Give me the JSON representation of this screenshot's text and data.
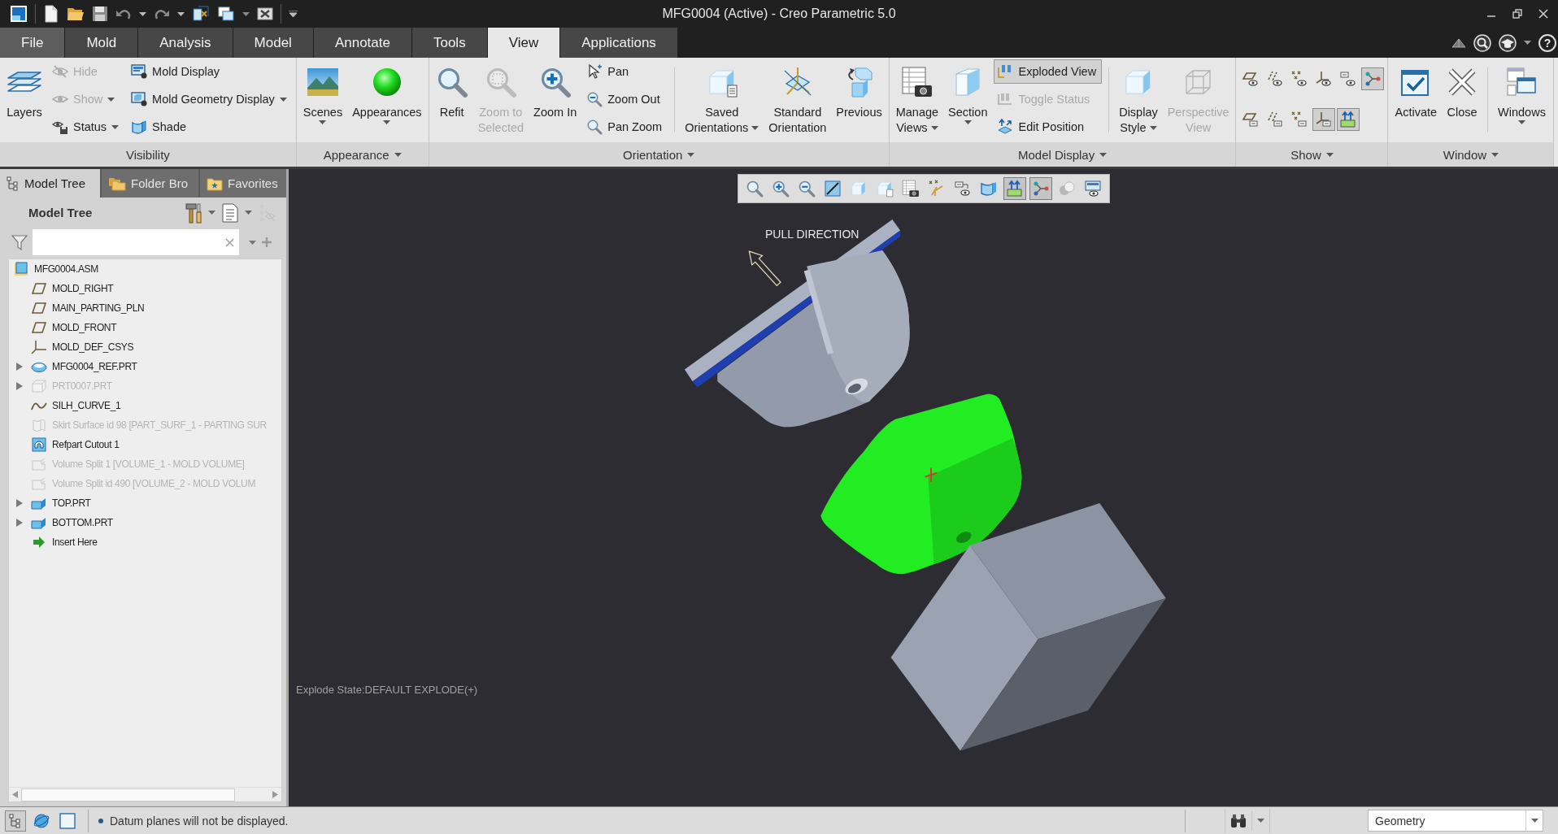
{
  "window": {
    "title": "MFG0004 (Active) - Creo Parametric 5.0"
  },
  "tabs": [
    {
      "label": "File",
      "selected": false
    },
    {
      "label": "Mold",
      "selected": false
    },
    {
      "label": "Analysis",
      "selected": false
    },
    {
      "label": "Model",
      "selected": false
    },
    {
      "label": "Annotate",
      "selected": false
    },
    {
      "label": "Tools",
      "selected": false
    },
    {
      "label": "View",
      "selected": true
    },
    {
      "label": "Applications",
      "selected": false
    }
  ],
  "help": "?",
  "ribbon": [
    {
      "label": "Visibility",
      "menu": false,
      "items": [
        {
          "kind": "large",
          "lines": [
            "Layers"
          ],
          "dropdown": false,
          "disabled": false
        },
        {
          "kind": "stack",
          "items": [
            {
              "label": "Hide",
              "dropdown": false,
              "disabled": true,
              "on": false
            },
            {
              "label": "Show",
              "dropdown": true,
              "disabled": true,
              "on": false
            },
            {
              "label": "Status",
              "dropdown": true,
              "disabled": false,
              "on": false
            }
          ]
        },
        {
          "kind": "stack",
          "items": [
            {
              "label": "Mold Display",
              "dropdown": false,
              "disabled": false,
              "on": false
            },
            {
              "label": "Mold Geometry Display",
              "dropdown": true,
              "disabled": false,
              "on": false
            },
            {
              "label": "Shade",
              "dropdown": false,
              "disabled": false,
              "on": false
            }
          ]
        }
      ]
    },
    {
      "label": "Appearance",
      "menu": true,
      "items": [
        {
          "kind": "large",
          "lines": [
            "Scenes"
          ],
          "dropdown": true,
          "disabled": false
        },
        {
          "kind": "large",
          "lines": [
            "Appearances"
          ],
          "dropdown": true,
          "disabled": false
        }
      ]
    },
    {
      "label": "Orientation",
      "menu": true,
      "items": [
        {
          "kind": "large",
          "lines": [
            "Refit"
          ],
          "dropdown": false,
          "disabled": false
        },
        {
          "kind": "large",
          "lines": [
            "Zoom to",
            "Selected"
          ],
          "dropdown": false,
          "disabled": true
        },
        {
          "kind": "large",
          "lines": [
            "Zoom In"
          ],
          "dropdown": false,
          "disabled": false
        },
        {
          "kind": "stack",
          "items": [
            {
              "label": "Pan",
              "dropdown": false,
              "disabled": false,
              "on": false
            },
            {
              "label": "Zoom Out",
              "dropdown": false,
              "disabled": false,
              "on": false
            },
            {
              "label": "Pan Zoom",
              "dropdown": false,
              "disabled": false,
              "on": false
            }
          ]
        },
        {
          "kind": "separator"
        },
        {
          "kind": "large",
          "lines": [
            "Saved",
            "Orientations"
          ],
          "dropdown": true,
          "disabled": false
        },
        {
          "kind": "large",
          "lines": [
            "Standard",
            "Orientation"
          ],
          "dropdown": false,
          "disabled": false
        },
        {
          "kind": "large",
          "lines": [
            "Previous"
          ],
          "dropdown": false,
          "disabled": false
        }
      ]
    },
    {
      "label": "Model Display",
      "menu": true,
      "items": [
        {
          "kind": "large",
          "lines": [
            "Manage",
            "Views"
          ],
          "dropdown": true,
          "disabled": false
        },
        {
          "kind": "large",
          "lines": [
            "Section"
          ],
          "dropdown": true,
          "disabled": false
        },
        {
          "kind": "stack",
          "items": [
            {
              "label": "Exploded View",
              "dropdown": false,
              "disabled": false,
              "on": true
            },
            {
              "label": "Toggle Status",
              "dropdown": false,
              "disabled": true,
              "on": false
            },
            {
              "label": "Edit Position",
              "dropdown": false,
              "disabled": false,
              "on": false
            }
          ]
        },
        {
          "kind": "separator"
        },
        {
          "kind": "large",
          "lines": [
            "Display",
            "Style"
          ],
          "dropdown": true,
          "disabled": false
        },
        {
          "kind": "large",
          "lines": [
            "Perspective",
            "View"
          ],
          "dropdown": false,
          "disabled": true
        }
      ]
    },
    {
      "label": "Show",
      "menu": true,
      "items": [
        {
          "kind": "toggles",
          "rows": [
            [
              {
                "on": false
              },
              {
                "on": false
              },
              {
                "on": false
              },
              {
                "on": false
              },
              {
                "on": false
              },
              {
                "on": true
              }
            ],
            [
              {
                "on": false
              },
              {
                "on": false
              },
              {
                "on": false
              },
              {
                "on": true
              },
              {
                "on": true
              }
            ]
          ]
        }
      ]
    },
    {
      "label": "Window",
      "menu": true,
      "items": [
        {
          "kind": "large",
          "lines": [
            "Activate"
          ],
          "dropdown": false,
          "disabled": false
        },
        {
          "kind": "large",
          "lines": [
            "Close"
          ],
          "dropdown": false,
          "disabled": false
        },
        {
          "kind": "separator"
        },
        {
          "kind": "large",
          "lines": [
            "Windows"
          ],
          "dropdown": true,
          "disabled": false
        }
      ]
    }
  ],
  "navigator": {
    "tabs": [
      {
        "label": "Model Tree",
        "selected": true
      },
      {
        "label": "Folder Bro",
        "selected": false
      },
      {
        "label": "Favorites",
        "selected": false
      }
    ],
    "title": "Model Tree",
    "tree": [
      {
        "kind": "assembly",
        "label": "MFG0004.ASM",
        "disabled": false,
        "collapsed": false,
        "children": [
          {
            "kind": "plane",
            "label": "MOLD_RIGHT",
            "disabled": false,
            "collapsed": false
          },
          {
            "kind": "plane",
            "label": "MAIN_PARTING_PLN",
            "disabled": false,
            "collapsed": false
          },
          {
            "kind": "plane",
            "label": "MOLD_FRONT",
            "disabled": false,
            "collapsed": false
          },
          {
            "kind": "csys",
            "label": "MOLD_DEF_CSYS",
            "disabled": false,
            "collapsed": false
          },
          {
            "kind": "refpart",
            "label": "MFG0004_REF.PRT",
            "disabled": false,
            "collapsed": true
          },
          {
            "kind": "workpiece",
            "label": "PRT0007.PRT",
            "disabled": true,
            "collapsed": true
          },
          {
            "kind": "curve",
            "label": "SILH_CURVE_1",
            "disabled": false,
            "collapsed": false
          },
          {
            "kind": "surface",
            "label": "Skirt Surface id 98 [PART_SURF_1 - PARTING SUR",
            "disabled": true,
            "collapsed": false
          },
          {
            "kind": "cutout",
            "label": "Refpart Cutout 1",
            "disabled": false,
            "collapsed": false
          },
          {
            "kind": "volume",
            "label": "Volume Split 1 [VOLUME_1 - MOLD VOLUME]",
            "disabled": true,
            "collapsed": false
          },
          {
            "kind": "volume",
            "label": "Volume Split id 490 [VOLUME_2 - MOLD VOLUM",
            "disabled": true,
            "collapsed": false
          },
          {
            "kind": "part",
            "label": "TOP.PRT",
            "disabled": false,
            "collapsed": true
          },
          {
            "kind": "part",
            "label": "BOTTOM.PRT",
            "disabled": false,
            "collapsed": true
          },
          {
            "kind": "insert",
            "label": "Insert Here",
            "disabled": false,
            "collapsed": false
          }
        ]
      }
    ]
  },
  "viewport": {
    "toolbar": [
      {
        "on": false
      },
      {
        "on": false
      },
      {
        "on": false
      },
      {
        "on": false
      },
      {
        "on": false
      },
      {
        "on": false
      },
      {
        "on": false
      },
      {
        "on": false
      },
      {
        "on": false
      },
      {
        "on": false
      },
      {
        "on": true
      },
      {
        "on": true
      },
      {
        "on": false
      },
      {
        "on": false
      }
    ],
    "label": "PULL DIRECTION",
    "explode_state": "Explode State:DEFAULT EXPLODE(+)"
  },
  "status_bar": {
    "tools": [
      {
        "on": true
      },
      {
        "on": false
      },
      {
        "on": false
      }
    ],
    "message": "Datum planes will not be displayed.",
    "filter": "Geometry"
  }
}
